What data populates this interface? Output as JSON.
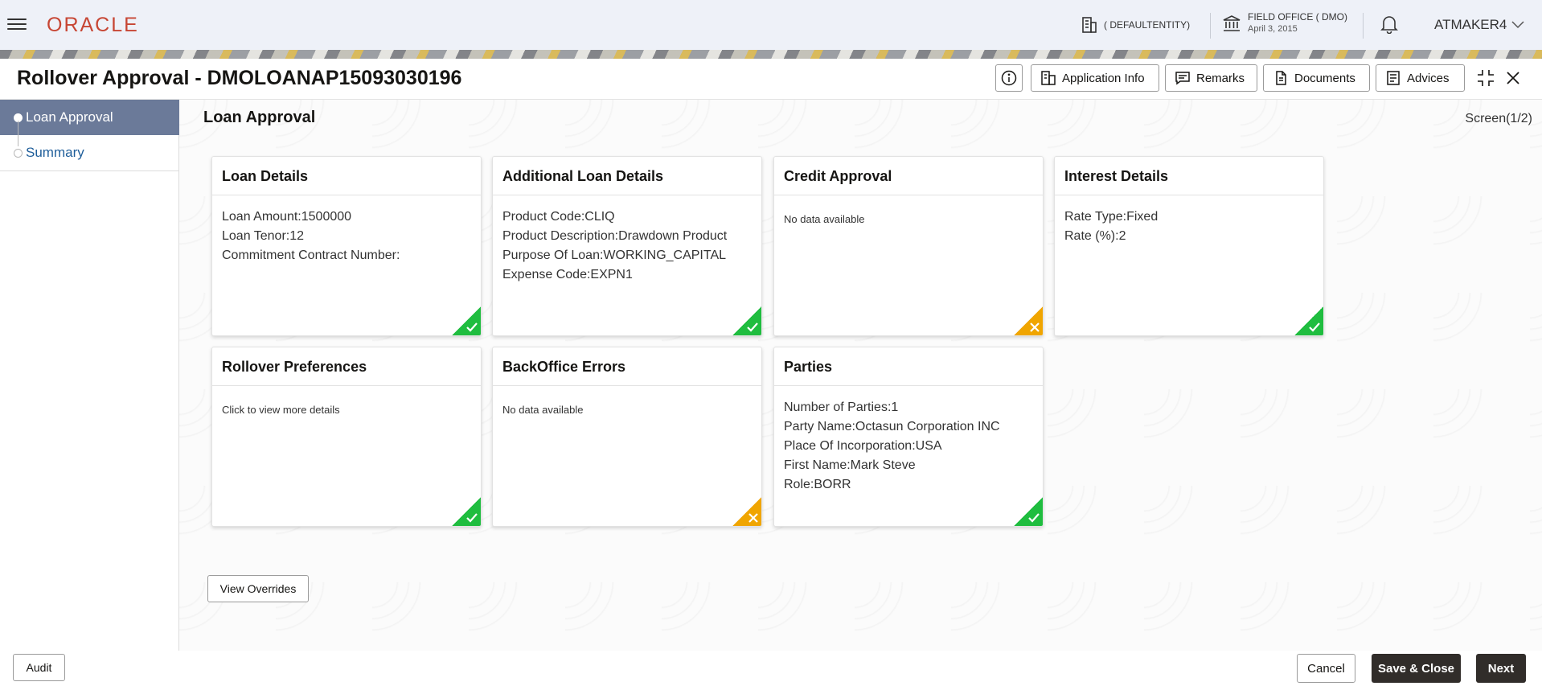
{
  "header": {
    "brand": "ORACLE",
    "entity": "( DEFAULTENTITY)",
    "office_name": "FIELD OFFICE ( DMO)",
    "office_date": "April 3, 2015",
    "user": "ATMAKER4",
    "brand_color": "#c74634"
  },
  "titlebar": {
    "title": "Rollover Approval - DMOLOANAP15093030196",
    "buttons": {
      "application_info": "Application Info",
      "remarks": "Remarks",
      "documents": "Documents",
      "advices": "Advices"
    }
  },
  "sidebar": {
    "steps": [
      {
        "label": "Loan Approval",
        "active": true
      },
      {
        "label": "Summary",
        "active": false
      }
    ]
  },
  "main": {
    "section_title": "Loan Approval",
    "screen_count": "Screen(1/2)",
    "cards": [
      {
        "title": "Loan Details",
        "lines": [
          "Loan Amount:1500000",
          "Loan Tenor:12",
          "Commitment Contract Number:"
        ],
        "status": "ok"
      },
      {
        "title": "Additional Loan Details",
        "lines": [
          "Product Code:CLIQ",
          "Product Description:Drawdown Product",
          "Purpose Of Loan:WORKING_CAPITAL",
          "Expense Code:EXPN1"
        ],
        "status": "ok"
      },
      {
        "title": "Credit Approval",
        "note": "No data available",
        "status": "warn"
      },
      {
        "title": "Interest Details",
        "lines": [
          "Rate Type:Fixed",
          "Rate (%):2"
        ],
        "status": "ok"
      },
      {
        "title": "Rollover Preferences",
        "note": "Click to view more details",
        "status": "ok"
      },
      {
        "title": "BackOffice Errors",
        "note": "No data available",
        "status": "warn"
      },
      {
        "title": "Parties",
        "lines": [
          "Number of Parties:1",
          "Party Name:Octasun Corporation INC",
          "Place Of Incorporation:USA",
          "First Name:Mark Steve",
          "Role:BORR"
        ],
        "status": "ok"
      }
    ],
    "view_overrides": "View Overrides"
  },
  "footer": {
    "audit": "Audit",
    "cancel": "Cancel",
    "save_close": "Save & Close",
    "next": "Next"
  },
  "colors": {
    "ok": "#1fbd3f",
    "warn": "#f0a500",
    "active_step": "#6b7a99",
    "dark_button": "#312d2a"
  }
}
